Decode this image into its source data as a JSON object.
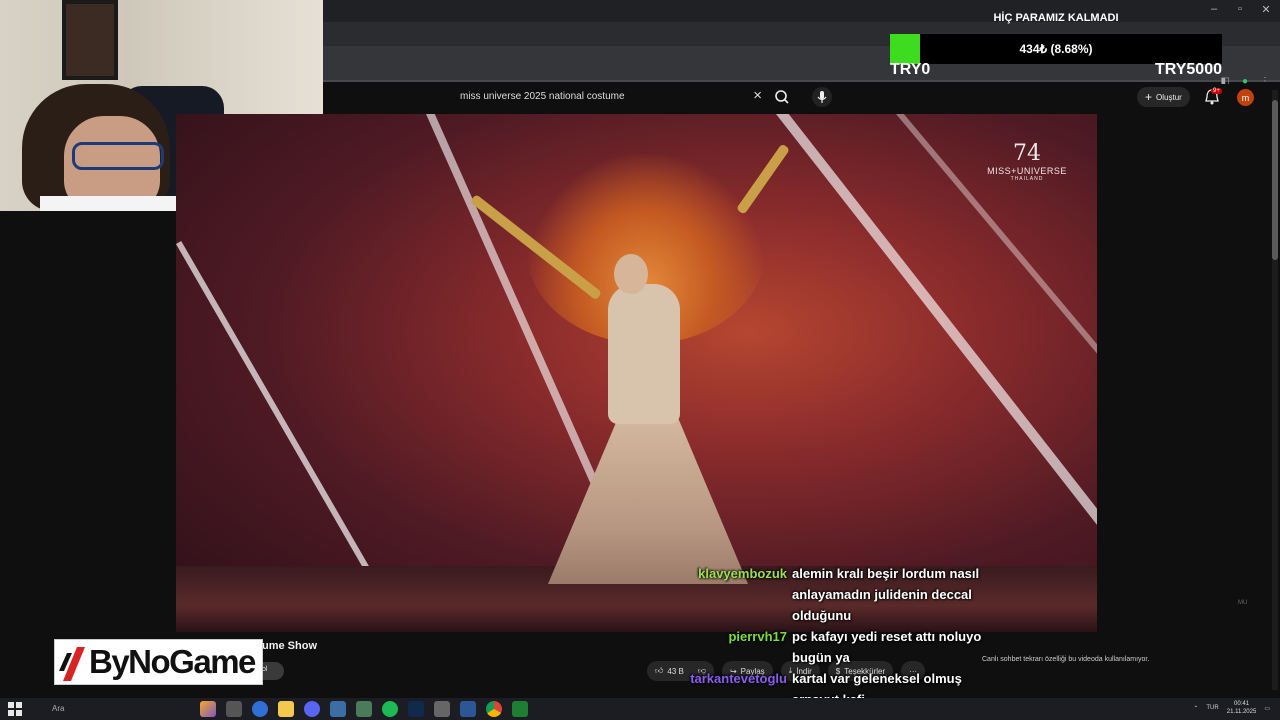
{
  "goal": {
    "title": "HİÇ PARAMIZ KALMADI",
    "amount_text": "434₺ (8.68%)",
    "progress_fraction": 0.0868,
    "min_label": "TRY0",
    "max_label": "TRY5000",
    "fill_color": "#3ddc1f"
  },
  "search": {
    "query": "miss universe 2025 national costume",
    "clear_icon": "×",
    "search_icon": "search-icon",
    "mic_icon": "mic-icon"
  },
  "header": {
    "create_label": "Oluştur",
    "notif_badge": "9+",
    "avatar_letter": "m"
  },
  "video": {
    "logo_number": "74",
    "logo_text": "MISS+UNIVERSE",
    "logo_sub": "THAILAND",
    "watermark": "MU"
  },
  "below_video": {
    "title_fragment": "ume Show",
    "chip_text": "ol",
    "likes": "43 B",
    "share_label": "Paylaş",
    "download_label": "İndir",
    "thanks_label": "Teşekkürler",
    "more_icon": "···",
    "chat_note": "Canlı sohbet tekrarı özelliği bu videoda kullanılamıyor."
  },
  "logo": {
    "text": "ByNoGame"
  },
  "chat": [
    {
      "user": "klavyembozuk",
      "color": "#9be04a",
      "lines": [
        "alemin kralı beşir lordum nasıl",
        "anlayamadın julidenin deccal",
        "olduğunu"
      ]
    },
    {
      "user": "pierrvh17",
      "color": "#7dde3a",
      "lines": [
        "pc kafayı yedi reset attı noluyo",
        "bugün ya"
      ]
    },
    {
      "user": "tarkantevetoglu",
      "color": "#8a5cf0",
      "lines": [
        "kartal var geleneksel olmuş",
        "arnavut kafi"
      ]
    }
  ],
  "taskbar": {
    "search_label": "Ara",
    "lang": "TUR",
    "time": "00:41",
    "date": "21.11.2025"
  }
}
